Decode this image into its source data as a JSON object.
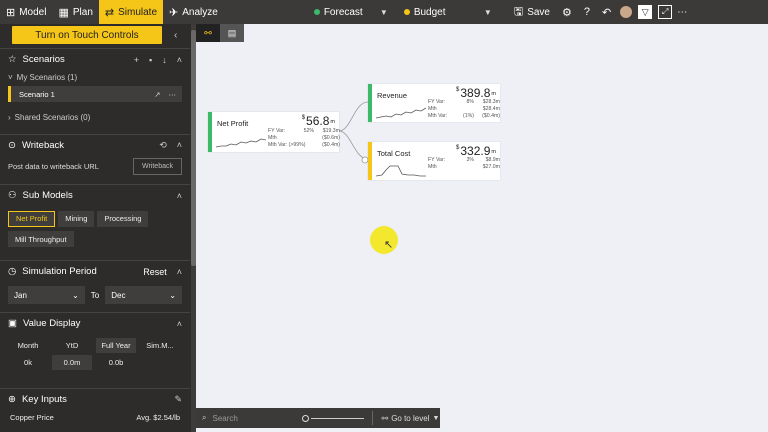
{
  "topbar": {
    "model": "Model",
    "plan": "Plan",
    "simulate": "Simulate",
    "analyze": "Analyze",
    "forecast": "Forecast",
    "budget": "Budget",
    "save": "Save",
    "forecast_color": "#3cba6a",
    "budget_color": "#f5c518"
  },
  "sidebar": {
    "touch_button": "Turn on Touch Controls",
    "scenarios": {
      "title": "Scenarios",
      "my_label": "My Scenarios (1)",
      "scenario_name": "Scenario 1",
      "shared_label": "Shared Scenarios (0)"
    },
    "writeback": {
      "title": "Writeback",
      "description": "Post data to writeback URL",
      "button": "Writeback"
    },
    "sub_models": {
      "title": "Sub Models",
      "items": [
        "Net Profit",
        "Mining",
        "Processing",
        "Mill Throughput"
      ],
      "selected": "Net Profit"
    },
    "simulation_period": {
      "title": "Simulation Period",
      "reset": "Reset",
      "from": "Jan",
      "to_label": "To",
      "to": "Dec"
    },
    "value_display": {
      "title": "Value Display",
      "periods": [
        "Month",
        "YtD",
        "Full Year",
        "Sim.M..."
      ],
      "selected_period": "Full Year",
      "formats": [
        "0k",
        "0.0m",
        "0.0b"
      ],
      "selected_format": "0.0m"
    },
    "key_inputs": {
      "title": "Key Inputs",
      "first_label": "Copper Price",
      "first_value": "Avg. $2.54/lb"
    }
  },
  "canvas": {
    "nodes": {
      "net_profit": {
        "title": "Net Profit",
        "currency": "$",
        "value": "56.8",
        "unit": "m",
        "rows": [
          [
            "FY Var:",
            "52%",
            "$19.3m"
          ],
          [
            "Mth",
            "",
            "($0.6m)"
          ],
          [
            "Mth Var: (>99%)",
            "",
            "($0.4m)"
          ]
        ],
        "color": "#3cba6a"
      },
      "revenue": {
        "title": "Revenue",
        "currency": "$",
        "value": "389.8",
        "unit": "m",
        "rows": [
          [
            "FY Var:",
            "8%",
            "$28.3m"
          ],
          [
            "Mth",
            "",
            "$28.4m"
          ],
          [
            "Mth Var:",
            "(1%)",
            "($0.4m)"
          ]
        ],
        "color": "#3cba6a"
      },
      "total_cost": {
        "title": "Total Cost",
        "currency": "$",
        "value": "332.9",
        "unit": "m",
        "rows": [
          [
            "FY Var:",
            "3%",
            "$8.9m"
          ],
          [
            "Mth",
            "",
            "$27.0m"
          ]
        ],
        "color": "#f5c518"
      }
    },
    "search_placeholder": "Search",
    "go_to_level": "Go to level"
  }
}
